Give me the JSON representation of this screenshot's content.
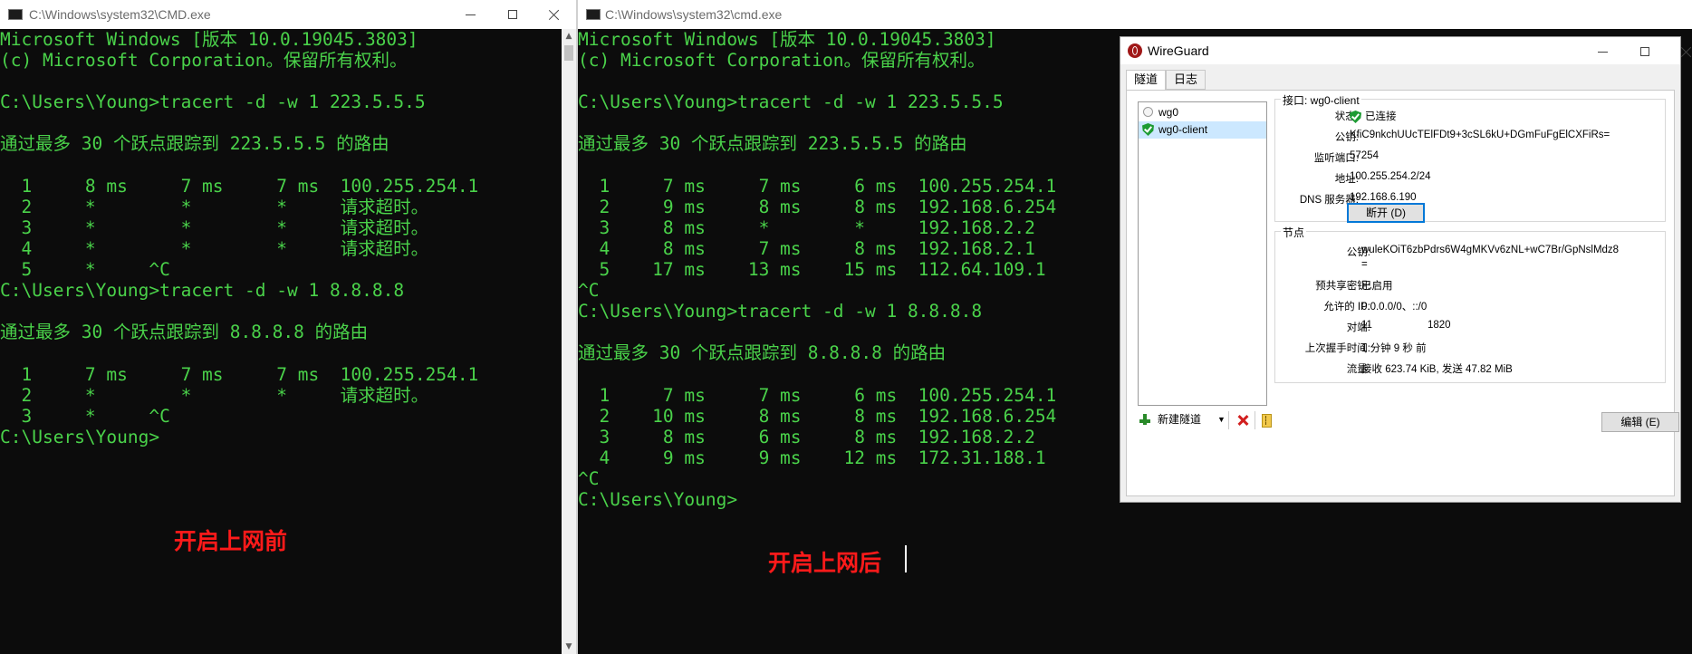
{
  "cmd_left": {
    "title": "C:\\Windows\\system32\\CMD.exe",
    "lines": [
      "Microsoft Windows [版本 10.0.19045.3803]",
      "(c) Microsoft Corporation。保留所有权利。",
      "",
      "C:\\Users\\Young>tracert -d -w 1 223.5.5.5",
      "",
      "通过最多 30 个跃点跟踪到 223.5.5.5 的路由",
      "",
      "  1     8 ms     7 ms     7 ms  100.255.254.1",
      "  2     *        *        *     请求超时。",
      "  3     *        *        *     请求超时。",
      "  4     *        *        *     请求超时。",
      "  5     *     ^C",
      "C:\\Users\\Young>tracert -d -w 1 8.8.8.8",
      "",
      "通过最多 30 个跃点跟踪到 8.8.8.8 的路由",
      "",
      "  1     7 ms     7 ms     7 ms  100.255.254.1",
      "  2     *        *        *     请求超时。",
      "  3     *     ^C",
      "C:\\Users\\Young>"
    ],
    "annotation": "开启上网前"
  },
  "cmd_right": {
    "title": "C:\\Windows\\system32\\cmd.exe",
    "lines": [
      "Microsoft Windows [版本 10.0.19045.3803]",
      "(c) Microsoft Corporation。保留所有权利。",
      "",
      "C:\\Users\\Young>tracert -d -w 1 223.5.5.5",
      "",
      "通过最多 30 个跃点跟踪到 223.5.5.5 的路由",
      "",
      "  1     7 ms     7 ms     6 ms  100.255.254.1",
      "  2     9 ms     8 ms     8 ms  192.168.6.254",
      "  3     8 ms     *        *     192.168.2.2",
      "  4     8 ms     7 ms     8 ms  192.168.2.1",
      "  5    17 ms    13 ms    15 ms  112.64.109.1",
      "^C",
      "C:\\Users\\Young>tracert -d -w 1 8.8.8.8",
      "",
      "通过最多 30 个跃点跟踪到 8.8.8.8 的路由",
      "",
      "  1     7 ms     7 ms     6 ms  100.255.254.1",
      "  2    10 ms     8 ms     8 ms  192.168.6.254",
      "  3     8 ms     6 ms     8 ms  192.168.2.2",
      "  4     9 ms     9 ms    12 ms  172.31.188.1",
      "^C",
      "C:\\Users\\Young>"
    ],
    "annotation": "开启上网后"
  },
  "wireguard": {
    "title": "WireGuard",
    "tabs": [
      "隧道",
      "日志"
    ],
    "tunnels": [
      {
        "name": "wg0",
        "active": false
      },
      {
        "name": "wg0-client",
        "active": true
      }
    ],
    "interface": {
      "title": "接口: wg0-client",
      "status_label": "状态:",
      "status_value": "已连接",
      "pubkey_label": "公钥:",
      "pubkey_value": "KfiC9nkchUUcTElFDt9+3cSL6kU+DGmFuFgElCXFiRs=",
      "port_label": "监听端口:",
      "port_value": "57254",
      "address_label": "地址:",
      "address_value": "100.255.254.2/24",
      "dns_label": "DNS 服务器:",
      "dns_value": "192.168.6.190",
      "disconnect_button": "断开 (D)"
    },
    "peer": {
      "title": "节点",
      "pubkey_label": "公钥:",
      "pubkey_value_1": "wuleKOiT6zbPdrs6W4gMKVv6zNL+wC7Br/GpNslMdz8",
      "pubkey_value_2": "=",
      "psk_label": "预共享密钥:",
      "psk_value": "已启用",
      "allowed_label": "允许的 IP:",
      "allowed_value": "0.0.0.0/0、::/0",
      "endpoint_label": "对端:",
      "endpoint_value_1": "11",
      "endpoint_value_2": "1820",
      "handshake_label": "上次握手时间:",
      "handshake_value": "1 分钟 9 秒 前",
      "transfer_label": "流量:",
      "transfer_value": "接收 623.74 KiB, 发送 47.82 MiB"
    },
    "add_tunnel_button": "新建隧道",
    "edit_button": "编辑 (E)"
  }
}
